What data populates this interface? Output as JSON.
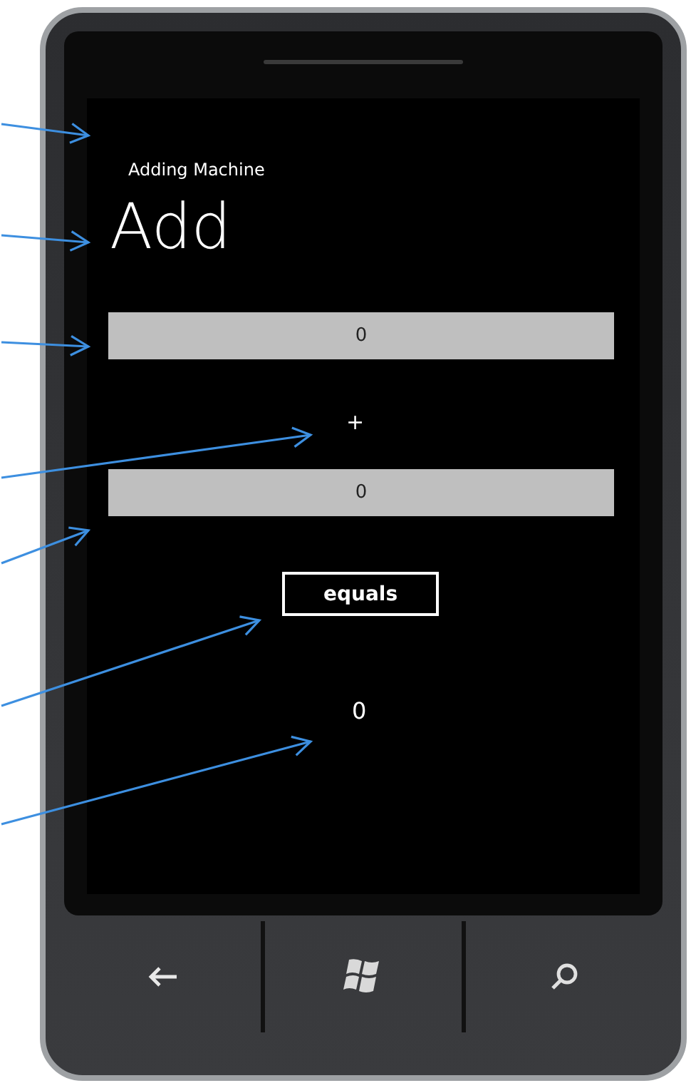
{
  "app_title": "Adding Machine",
  "page_title": "Add",
  "first_number": {
    "value": "0"
  },
  "operator": "+",
  "second_number": {
    "value": "0"
  },
  "equals_button": {
    "label": "equals"
  },
  "result": "0"
}
